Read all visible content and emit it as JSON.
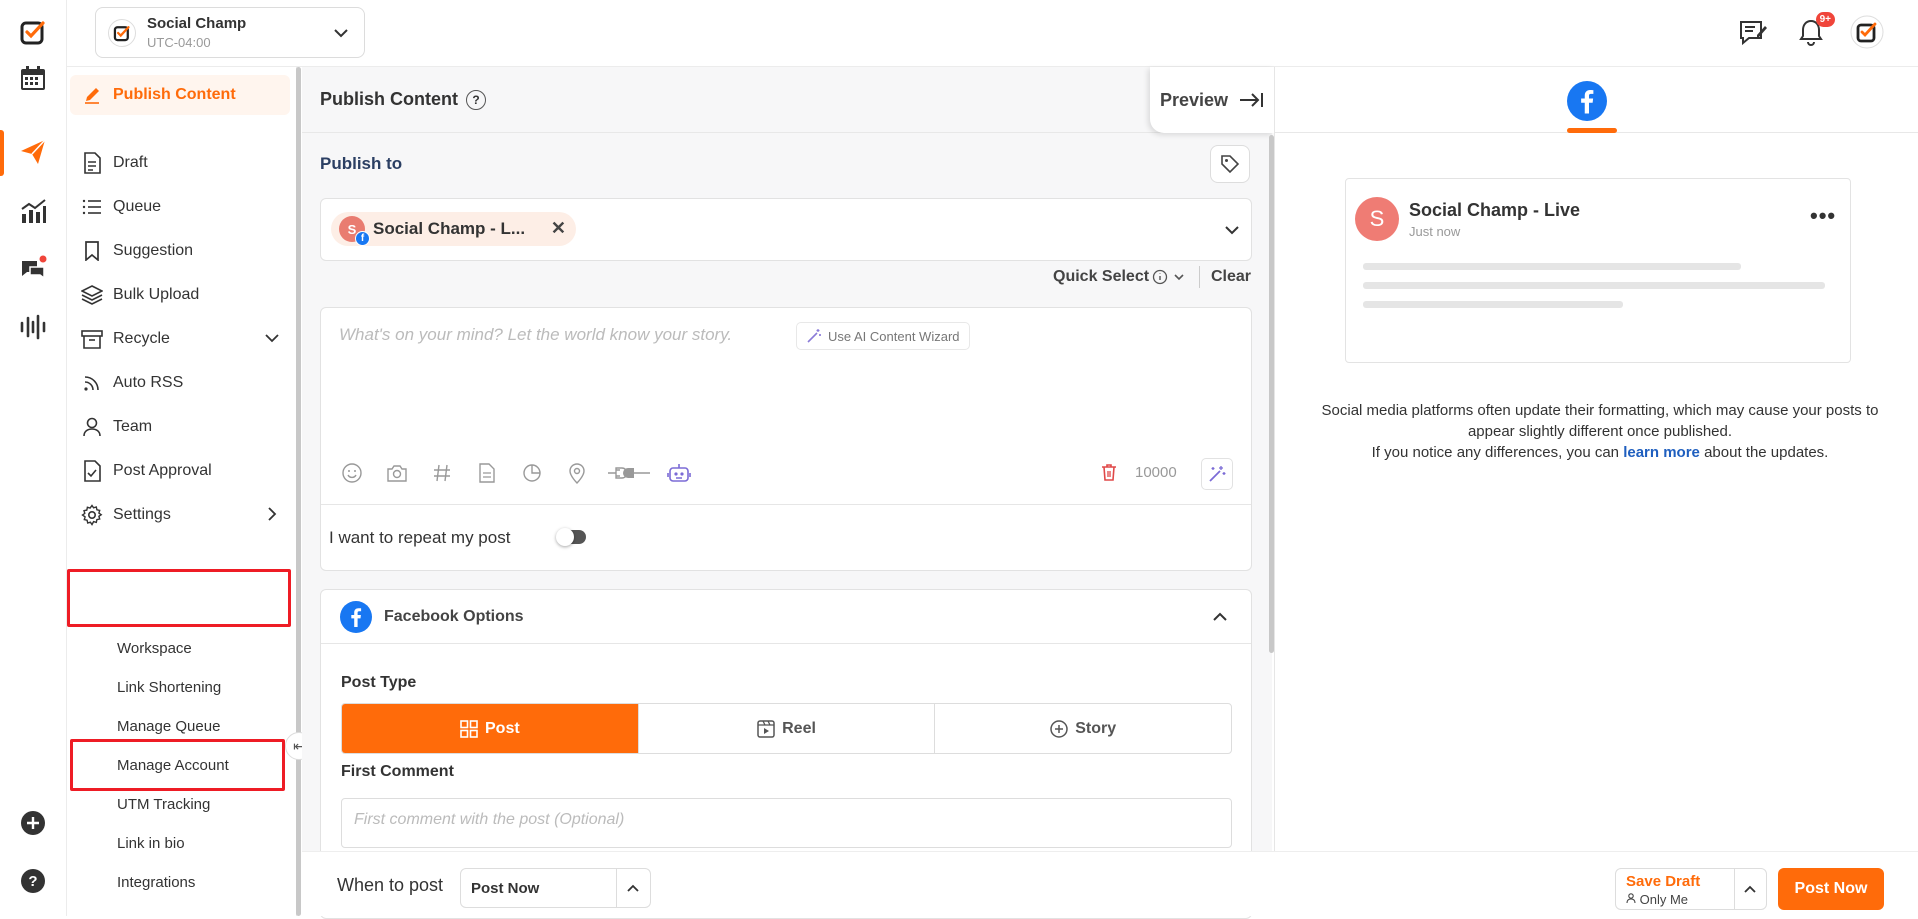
{
  "header": {
    "account_name": "Social Champ",
    "timezone": "UTC-04:00",
    "notification_count": "9+"
  },
  "sidebar": {
    "items": [
      {
        "label": "Publish Content"
      },
      {
        "label": "Draft"
      },
      {
        "label": "Queue"
      },
      {
        "label": "Suggestion"
      },
      {
        "label": "Bulk Upload"
      },
      {
        "label": "Recycle"
      },
      {
        "label": "Auto RSS"
      },
      {
        "label": "Team"
      },
      {
        "label": "Post Approval"
      },
      {
        "label": "Settings"
      }
    ],
    "settings_sub": [
      {
        "label": "Workspace"
      },
      {
        "label": "Link Shortening"
      },
      {
        "label": "Manage Queue"
      },
      {
        "label": "Manage Account"
      },
      {
        "label": "UTM Tracking"
      },
      {
        "label": "Link in bio"
      },
      {
        "label": "Integrations"
      }
    ]
  },
  "main": {
    "title": "Publish Content",
    "preview_label": "Preview",
    "publish_to": "Publish to",
    "selected_account": "Social Champ - L...",
    "selected_account_initial": "S",
    "quick_select": "Quick Select",
    "clear": "Clear",
    "editor_placeholder": "What's on your mind? Let the world know your story.",
    "ai_wizard": "Use AI Content Wizard",
    "char_count": "10000",
    "repeat_label": "I want to repeat my post",
    "fb_options_title": "Facebook Options",
    "post_type_label": "Post Type",
    "post_types": [
      {
        "label": "Post"
      },
      {
        "label": "Reel"
      },
      {
        "label": "Story"
      }
    ],
    "first_comment_label": "First Comment",
    "first_comment_placeholder": "First comment with the post (Optional)"
  },
  "footer": {
    "when_label": "When to post",
    "when_value": "Post Now",
    "save_draft": "Save Draft",
    "save_draft_sub": "Only Me",
    "post_now": "Post Now"
  },
  "preview": {
    "page_name": "Social Champ - Live",
    "page_initial": "S",
    "time": "Just now",
    "note_1": "Social media platforms often update their formatting, which may cause your posts to appear slightly different once published.",
    "note_2": "If you notice any differences, you can",
    "note_link": "learn more",
    "note_3": "about the updates."
  },
  "colors": {
    "accent": "#ff6b0a",
    "facebook": "#1877f2",
    "highlight": "#ee1c25"
  }
}
